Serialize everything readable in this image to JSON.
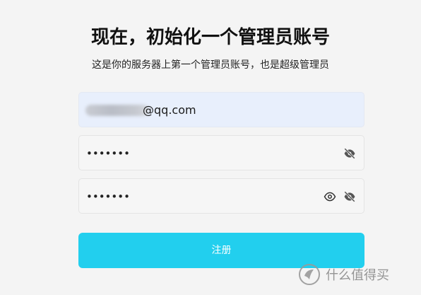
{
  "header": {
    "title": "现在，初始化一个管理员账号",
    "subtitle": "这是你的服务器上第一个管理员账号，也是超级管理员"
  },
  "form": {
    "email_value": "@qq.com",
    "password_value": "•••••••",
    "confirm_password_value": "•••••••",
    "submit_label": "注册"
  },
  "icons": {
    "password_toggle": "eye-slash-icon",
    "confirm_show": "eye-icon",
    "confirm_toggle": "eye-slash-icon"
  },
  "colors": {
    "background": "#f4f4f4",
    "email_field_bg": "#e8effc",
    "submit_bg": "#22cfee",
    "icon": "#555555"
  },
  "watermark": {
    "text": "什么值得买"
  }
}
